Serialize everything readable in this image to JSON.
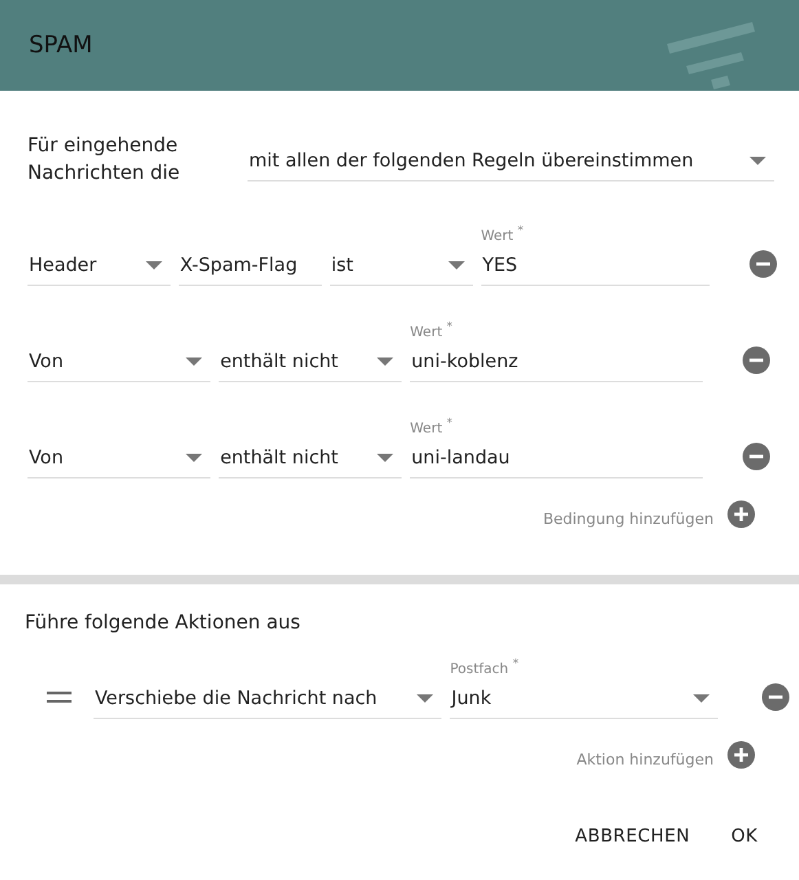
{
  "dialog": {
    "title": "SPAM"
  },
  "match": {
    "label": "Für eingehende Nachrichten die",
    "value": "mit allen der folgenden Regeln übereinstimmen"
  },
  "conditions": [
    {
      "fields": [
        {
          "kind": "select",
          "value": "Header"
        },
        {
          "kind": "text",
          "value": "X-Spam-Flag"
        },
        {
          "kind": "select",
          "value": "ist"
        },
        {
          "kind": "text",
          "label": "Wert $^{*}$",
          "value": "YES"
        }
      ]
    },
    {
      "fields": [
        {
          "kind": "select",
          "value": "Von"
        },
        {
          "kind": "select",
          "value": "enthält nicht"
        },
        {
          "kind": "text",
          "label": "Wert $^{*}$",
          "value": "uni-koblenz"
        }
      ]
    },
    {
      "fields": [
        {
          "kind": "select",
          "value": "Von"
        },
        {
          "kind": "select",
          "value": "enthält nicht"
        },
        {
          "kind": "text",
          "label": "Wert $^{*}$",
          "value": "uni-landau"
        }
      ]
    }
  ],
  "add_condition": "Bedingung hinzufügen",
  "actions_title": "Führe folgende Aktionen aus",
  "actions": [
    {
      "fields": [
        {
          "kind": "select",
          "value": "Verschiebe die Nachricht nach"
        },
        {
          "kind": "select",
          "label": "Postfach $^{*}$",
          "value": "Junk"
        }
      ]
    }
  ],
  "add_action": "Aktion hinzufügen",
  "buttons": [
    "ABBRECHEN",
    "OK"
  ]
}
